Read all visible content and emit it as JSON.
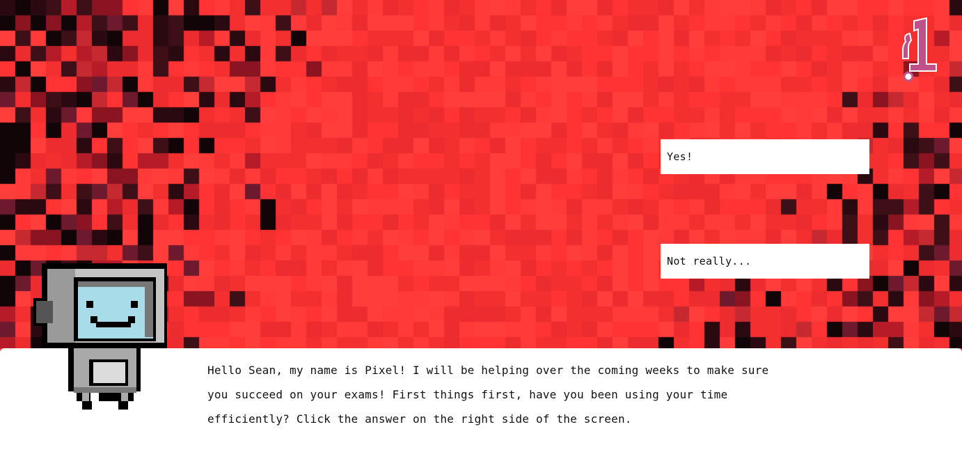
{
  "choices": {
    "yes_label": "Yes!",
    "no_label": "Not really..."
  },
  "dialog": {
    "message": "Hello Sean, my name is Pixel! I will be helping over the coming weeks to make sure you succeed on your exams! First things first, have you been using your time efficiently? Click the answer on the right side of the screen."
  },
  "logo": {
    "glyph": "!"
  },
  "theme": {
    "background": "#ff3333",
    "panel": "#ffffff",
    "screen_color": "#a8dce8",
    "logo_color": "#c0508a"
  },
  "icons": [
    "robot-mascot-icon",
    "logo-icon"
  ]
}
